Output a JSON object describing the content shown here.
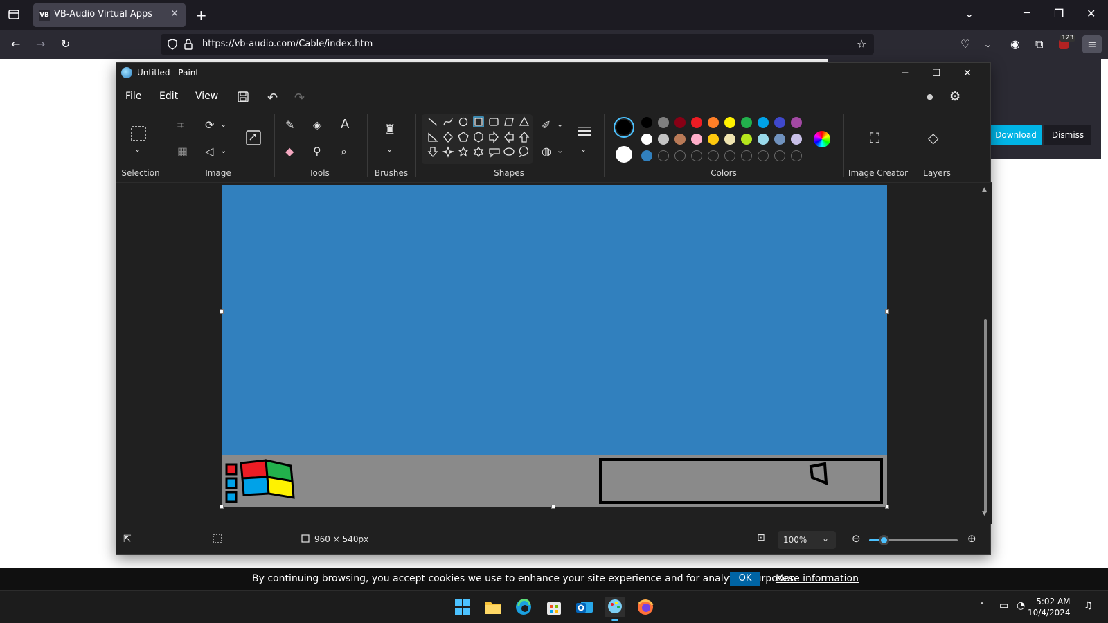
{
  "browser": {
    "tab_title": "VB-Audio Virtual Apps",
    "tab_favicon_text": "VB",
    "url": "https://vb-audio.com/Cable/index.htm",
    "badge_count": "123"
  },
  "page_notice": {
    "download_label": "Download",
    "dismiss_label": "Dismiss"
  },
  "paint": {
    "window_title": "Untitled - Paint",
    "menu": {
      "file": "File",
      "edit": "Edit",
      "view": "View"
    },
    "groups": {
      "selection": "Selection",
      "image": "Image",
      "tools": "Tools",
      "brushes": "Brushes",
      "shapes": "Shapes",
      "colors": "Colors",
      "image_creator": "Image Creator",
      "layers": "Layers"
    },
    "palette_row1": [
      "#000000",
      "#7f7f7f",
      "#880015",
      "#ed1c24",
      "#ff7f27",
      "#fff200",
      "#22b14c",
      "#00a2e8",
      "#3f48cc",
      "#a349a4"
    ],
    "palette_row2": [
      "#ffffff",
      "#c3c3c3",
      "#b97a57",
      "#ffaec9",
      "#ffc90e",
      "#efe4b0",
      "#b5e61d",
      "#99d9ea",
      "#7092be",
      "#c8bfe7"
    ],
    "palette_row3_first": "#3180be",
    "primary_color": "#000000",
    "secondary_color": "#ffffff",
    "canvas_color": "#3180be",
    "status": {
      "canvas_size": "960 × 540px",
      "zoom": "100%",
      "zoom_level": 0.17
    }
  },
  "cookie_bar": {
    "text": "By continuing browsing, you accept cookies we use to enhance your site experience and for analytics purposes.",
    "ok_label": "OK",
    "more_label": "More information"
  },
  "system": {
    "time": "5:02 AM",
    "date": "10/4/2024"
  }
}
